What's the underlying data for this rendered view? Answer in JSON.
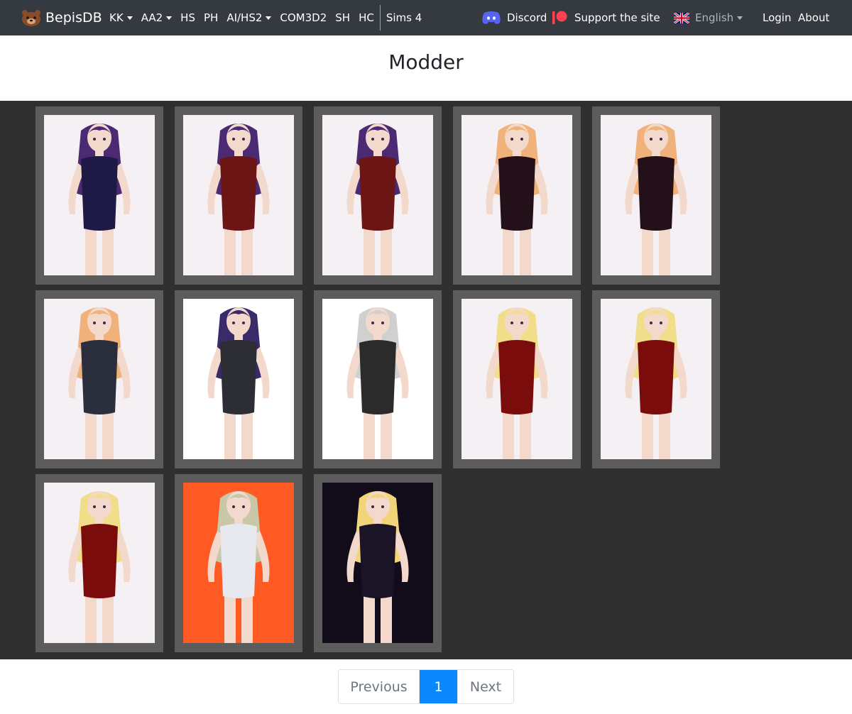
{
  "navbar": {
    "brand": "BepisDB",
    "items": [
      {
        "label": "KK",
        "dropdown": true
      },
      {
        "label": "AA2",
        "dropdown": true
      },
      {
        "label": "HS",
        "dropdown": false
      },
      {
        "label": "PH",
        "dropdown": false
      },
      {
        "label": "AI/HS2",
        "dropdown": true
      },
      {
        "label": "COM3D2",
        "dropdown": false
      },
      {
        "label": "SH",
        "dropdown": false
      },
      {
        "label": "HC",
        "dropdown": false
      },
      {
        "label": "Sims 4",
        "dropdown": false
      }
    ],
    "discord": "Discord",
    "support": "Support the site",
    "language": "English",
    "login": "Login",
    "about": "About"
  },
  "page": {
    "title": "Modder"
  },
  "gallery": {
    "cards": [
      {
        "hair": "#4b2a73",
        "outfit": "#1e1a45",
        "skin": "#f3d9cc",
        "bg": "#f5f0f4"
      },
      {
        "hair": "#4b2a73",
        "outfit": "#6b1515",
        "skin": "#f3d9cc",
        "bg": "#f5f0f4"
      },
      {
        "hair": "#4b2a73",
        "outfit": "#6b1515",
        "skin": "#f3d9cc",
        "bg": "#f5f0f4"
      },
      {
        "hair": "#f0b27a",
        "outfit": "#241018",
        "skin": "#f3d9cc",
        "bg": "#f5f0f4"
      },
      {
        "hair": "#f0b27a",
        "outfit": "#241018",
        "skin": "#f3d9cc",
        "bg": "#f5f0f4"
      },
      {
        "hair": "#f0b27a",
        "outfit": "#2b2f3d",
        "skin": "#f3d9cc",
        "bg": "#f5f0f4"
      },
      {
        "hair": "#3a2a6a",
        "outfit": "#2d2d34",
        "skin": "#f3d9cc",
        "bg": "#ffffff"
      },
      {
        "hair": "#d0d0d0",
        "outfit": "#2b2b2b",
        "skin": "#f3d9cc",
        "bg": "#ffffff"
      },
      {
        "hair": "#f2de8a",
        "outfit": "#7a0c0c",
        "skin": "#f3d9cc",
        "bg": "#f5f0f4"
      },
      {
        "hair": "#f2de8a",
        "outfit": "#7a0c0c",
        "skin": "#f3d9cc",
        "bg": "#f5f0f4"
      },
      {
        "hair": "#f2de8a",
        "outfit": "#7a0c0c",
        "skin": "#f3d9cc",
        "bg": "#f5f0f4"
      },
      {
        "hair": "#c8c8a8",
        "outfit": "#e8e8f0",
        "skin": "#f3d9cc",
        "bg": "#ff5a24"
      },
      {
        "hair": "#f2d47a",
        "outfit": "#1a1426",
        "skin": "#f3d9cc",
        "bg": "#120c1a"
      }
    ]
  },
  "pagination": {
    "previous": "Previous",
    "current": "1",
    "next": "Next"
  },
  "colors": {
    "navbar_bg": "#343a40",
    "gallery_bg": "#2f2f2f",
    "card_bg": "#5c5c5c",
    "page_active": "#0d87fd",
    "discord": "#5865f2",
    "patreon": "#ff424d"
  }
}
